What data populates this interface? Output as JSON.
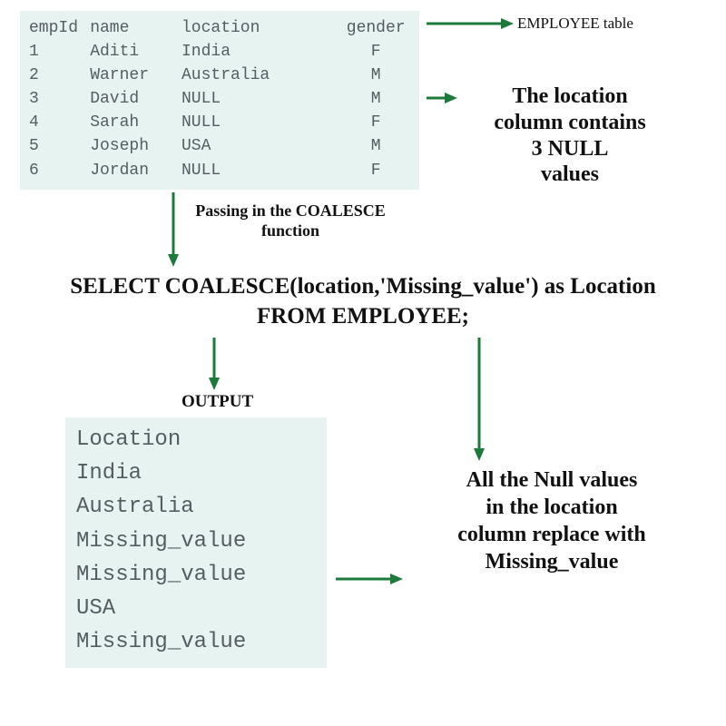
{
  "employee_table": {
    "headers": {
      "empId": "empId",
      "name": "name",
      "location": "location",
      "gender": "gender"
    },
    "rows": [
      {
        "empId": "1",
        "name": "Aditi",
        "location": "India",
        "gender": "F"
      },
      {
        "empId": "2",
        "name": "Warner",
        "location": "Australia",
        "gender": "M"
      },
      {
        "empId": "3",
        "name": "David",
        "location": "NULL",
        "gender": "M"
      },
      {
        "empId": "4",
        "name": "Sarah",
        "location": "NULL",
        "gender": "F"
      },
      {
        "empId": "5",
        "name": "Joseph",
        "location": "USA",
        "gender": "M"
      },
      {
        "empId": "6",
        "name": "Jordan",
        "location": "NULL",
        "gender": "F"
      }
    ]
  },
  "notes": {
    "employee_label": "EMPLOYEE table",
    "null_count_1": "The location",
    "null_count_2": "column contains",
    "null_count_3": "3 NULL",
    "null_count_4": "values",
    "pass1": "Passing in the COALESCE",
    "pass2": "function",
    "output_label": "OUTPUT",
    "replace_1": "All the Null values",
    "replace_2": "in the location",
    "replace_3": "column replace with",
    "replace_4": "Missing_value"
  },
  "sql": {
    "line1": "SELECT COALESCE(location,'Missing_value') as Location",
    "line2": "FROM EMPLOYEE;"
  },
  "output": {
    "header": "Location",
    "rows": [
      "India",
      "Australia",
      "Missing_value",
      "Missing_value",
      "USA",
      "Missing_value"
    ]
  },
  "colors": {
    "arrow": "#1c7a3a",
    "panel": "#e6f3f1"
  }
}
